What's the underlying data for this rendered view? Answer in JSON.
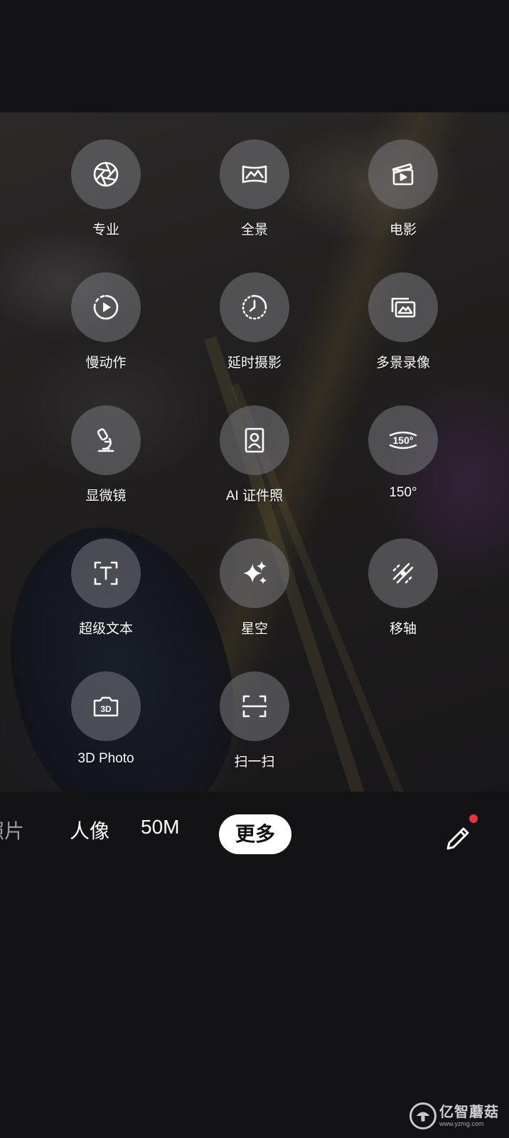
{
  "modes": [
    {
      "label": "专业",
      "icon": "aperture-icon"
    },
    {
      "label": "全景",
      "icon": "panorama-icon"
    },
    {
      "label": "电影",
      "icon": "clapperboard-icon"
    },
    {
      "label": "慢动作",
      "icon": "slow-motion-icon"
    },
    {
      "label": "延时摄影",
      "icon": "timelapse-icon"
    },
    {
      "label": "多景录像",
      "icon": "multi-scene-icon"
    },
    {
      "label": "显微镜",
      "icon": "microscope-icon"
    },
    {
      "label": "AI 证件照",
      "icon": "id-photo-icon"
    },
    {
      "label": "150°",
      "icon": "wide-150-icon"
    },
    {
      "label": "超级文本",
      "icon": "text-scan-icon"
    },
    {
      "label": "星空",
      "icon": "sparkle-icon"
    },
    {
      "label": "移轴",
      "icon": "tilt-shift-icon"
    },
    {
      "label": "3D Photo",
      "icon": "3d-photo-icon"
    },
    {
      "label": "扫一扫",
      "icon": "scan-icon"
    }
  ],
  "mode_bar": {
    "tabs": [
      "照片",
      "人像",
      "50M",
      "更多"
    ],
    "active": "更多",
    "edit_icon": "pencil-icon",
    "notification_dot_color": "#e8333f"
  },
  "watermark": {
    "title": "亿智蘑菇",
    "url": "www.yzmg.com"
  }
}
